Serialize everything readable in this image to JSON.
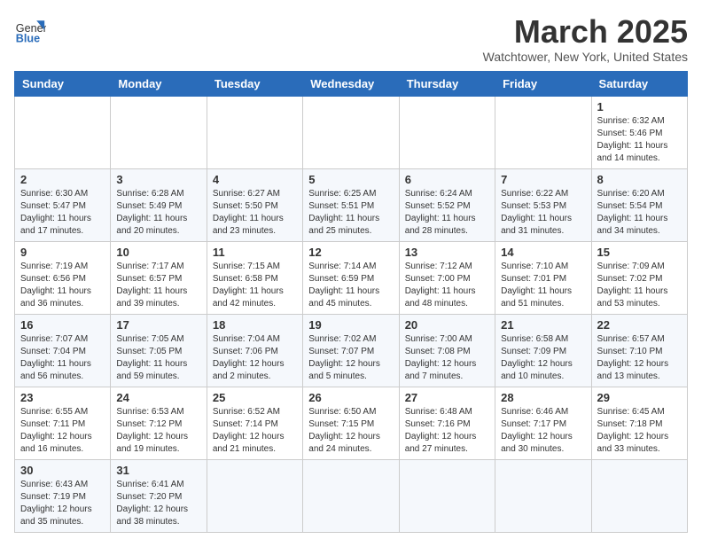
{
  "header": {
    "logo_general": "General",
    "logo_blue": "Blue",
    "month_title": "March 2025",
    "location": "Watchtower, New York, United States"
  },
  "weekdays": [
    "Sunday",
    "Monday",
    "Tuesday",
    "Wednesday",
    "Thursday",
    "Friday",
    "Saturday"
  ],
  "weeks": [
    [
      {
        "day": "",
        "info": ""
      },
      {
        "day": "",
        "info": ""
      },
      {
        "day": "",
        "info": ""
      },
      {
        "day": "",
        "info": ""
      },
      {
        "day": "",
        "info": ""
      },
      {
        "day": "",
        "info": ""
      },
      {
        "day": "1",
        "info": "Sunrise: 6:32 AM\nSunset: 5:46 PM\nDaylight: 11 hours and 14 minutes."
      }
    ],
    [
      {
        "day": "2",
        "info": "Sunrise: 6:30 AM\nSunset: 5:47 PM\nDaylight: 11 hours and 17 minutes."
      },
      {
        "day": "3",
        "info": "Sunrise: 6:28 AM\nSunset: 5:49 PM\nDaylight: 11 hours and 20 minutes."
      },
      {
        "day": "4",
        "info": "Sunrise: 6:27 AM\nSunset: 5:50 PM\nDaylight: 11 hours and 23 minutes."
      },
      {
        "day": "5",
        "info": "Sunrise: 6:25 AM\nSunset: 5:51 PM\nDaylight: 11 hours and 25 minutes."
      },
      {
        "day": "6",
        "info": "Sunrise: 6:24 AM\nSunset: 5:52 PM\nDaylight: 11 hours and 28 minutes."
      },
      {
        "day": "7",
        "info": "Sunrise: 6:22 AM\nSunset: 5:53 PM\nDaylight: 11 hours and 31 minutes."
      },
      {
        "day": "8",
        "info": "Sunrise: 6:20 AM\nSunset: 5:54 PM\nDaylight: 11 hours and 34 minutes."
      }
    ],
    [
      {
        "day": "9",
        "info": "Sunrise: 7:19 AM\nSunset: 6:56 PM\nDaylight: 11 hours and 36 minutes."
      },
      {
        "day": "10",
        "info": "Sunrise: 7:17 AM\nSunset: 6:57 PM\nDaylight: 11 hours and 39 minutes."
      },
      {
        "day": "11",
        "info": "Sunrise: 7:15 AM\nSunset: 6:58 PM\nDaylight: 11 hours and 42 minutes."
      },
      {
        "day": "12",
        "info": "Sunrise: 7:14 AM\nSunset: 6:59 PM\nDaylight: 11 hours and 45 minutes."
      },
      {
        "day": "13",
        "info": "Sunrise: 7:12 AM\nSunset: 7:00 PM\nDaylight: 11 hours and 48 minutes."
      },
      {
        "day": "14",
        "info": "Sunrise: 7:10 AM\nSunset: 7:01 PM\nDaylight: 11 hours and 51 minutes."
      },
      {
        "day": "15",
        "info": "Sunrise: 7:09 AM\nSunset: 7:02 PM\nDaylight: 11 hours and 53 minutes."
      }
    ],
    [
      {
        "day": "16",
        "info": "Sunrise: 7:07 AM\nSunset: 7:04 PM\nDaylight: 11 hours and 56 minutes."
      },
      {
        "day": "17",
        "info": "Sunrise: 7:05 AM\nSunset: 7:05 PM\nDaylight: 11 hours and 59 minutes."
      },
      {
        "day": "18",
        "info": "Sunrise: 7:04 AM\nSunset: 7:06 PM\nDaylight: 12 hours and 2 minutes."
      },
      {
        "day": "19",
        "info": "Sunrise: 7:02 AM\nSunset: 7:07 PM\nDaylight: 12 hours and 5 minutes."
      },
      {
        "day": "20",
        "info": "Sunrise: 7:00 AM\nSunset: 7:08 PM\nDaylight: 12 hours and 7 minutes."
      },
      {
        "day": "21",
        "info": "Sunrise: 6:58 AM\nSunset: 7:09 PM\nDaylight: 12 hours and 10 minutes."
      },
      {
        "day": "22",
        "info": "Sunrise: 6:57 AM\nSunset: 7:10 PM\nDaylight: 12 hours and 13 minutes."
      }
    ],
    [
      {
        "day": "23",
        "info": "Sunrise: 6:55 AM\nSunset: 7:11 PM\nDaylight: 12 hours and 16 minutes."
      },
      {
        "day": "24",
        "info": "Sunrise: 6:53 AM\nSunset: 7:12 PM\nDaylight: 12 hours and 19 minutes."
      },
      {
        "day": "25",
        "info": "Sunrise: 6:52 AM\nSunset: 7:14 PM\nDaylight: 12 hours and 21 minutes."
      },
      {
        "day": "26",
        "info": "Sunrise: 6:50 AM\nSunset: 7:15 PM\nDaylight: 12 hours and 24 minutes."
      },
      {
        "day": "27",
        "info": "Sunrise: 6:48 AM\nSunset: 7:16 PM\nDaylight: 12 hours and 27 minutes."
      },
      {
        "day": "28",
        "info": "Sunrise: 6:46 AM\nSunset: 7:17 PM\nDaylight: 12 hours and 30 minutes."
      },
      {
        "day": "29",
        "info": "Sunrise: 6:45 AM\nSunset: 7:18 PM\nDaylight: 12 hours and 33 minutes."
      }
    ],
    [
      {
        "day": "30",
        "info": "Sunrise: 6:43 AM\nSunset: 7:19 PM\nDaylight: 12 hours and 35 minutes."
      },
      {
        "day": "31",
        "info": "Sunrise: 6:41 AM\nSunset: 7:20 PM\nDaylight: 12 hours and 38 minutes."
      },
      {
        "day": "",
        "info": ""
      },
      {
        "day": "",
        "info": ""
      },
      {
        "day": "",
        "info": ""
      },
      {
        "day": "",
        "info": ""
      },
      {
        "day": "",
        "info": ""
      }
    ]
  ]
}
